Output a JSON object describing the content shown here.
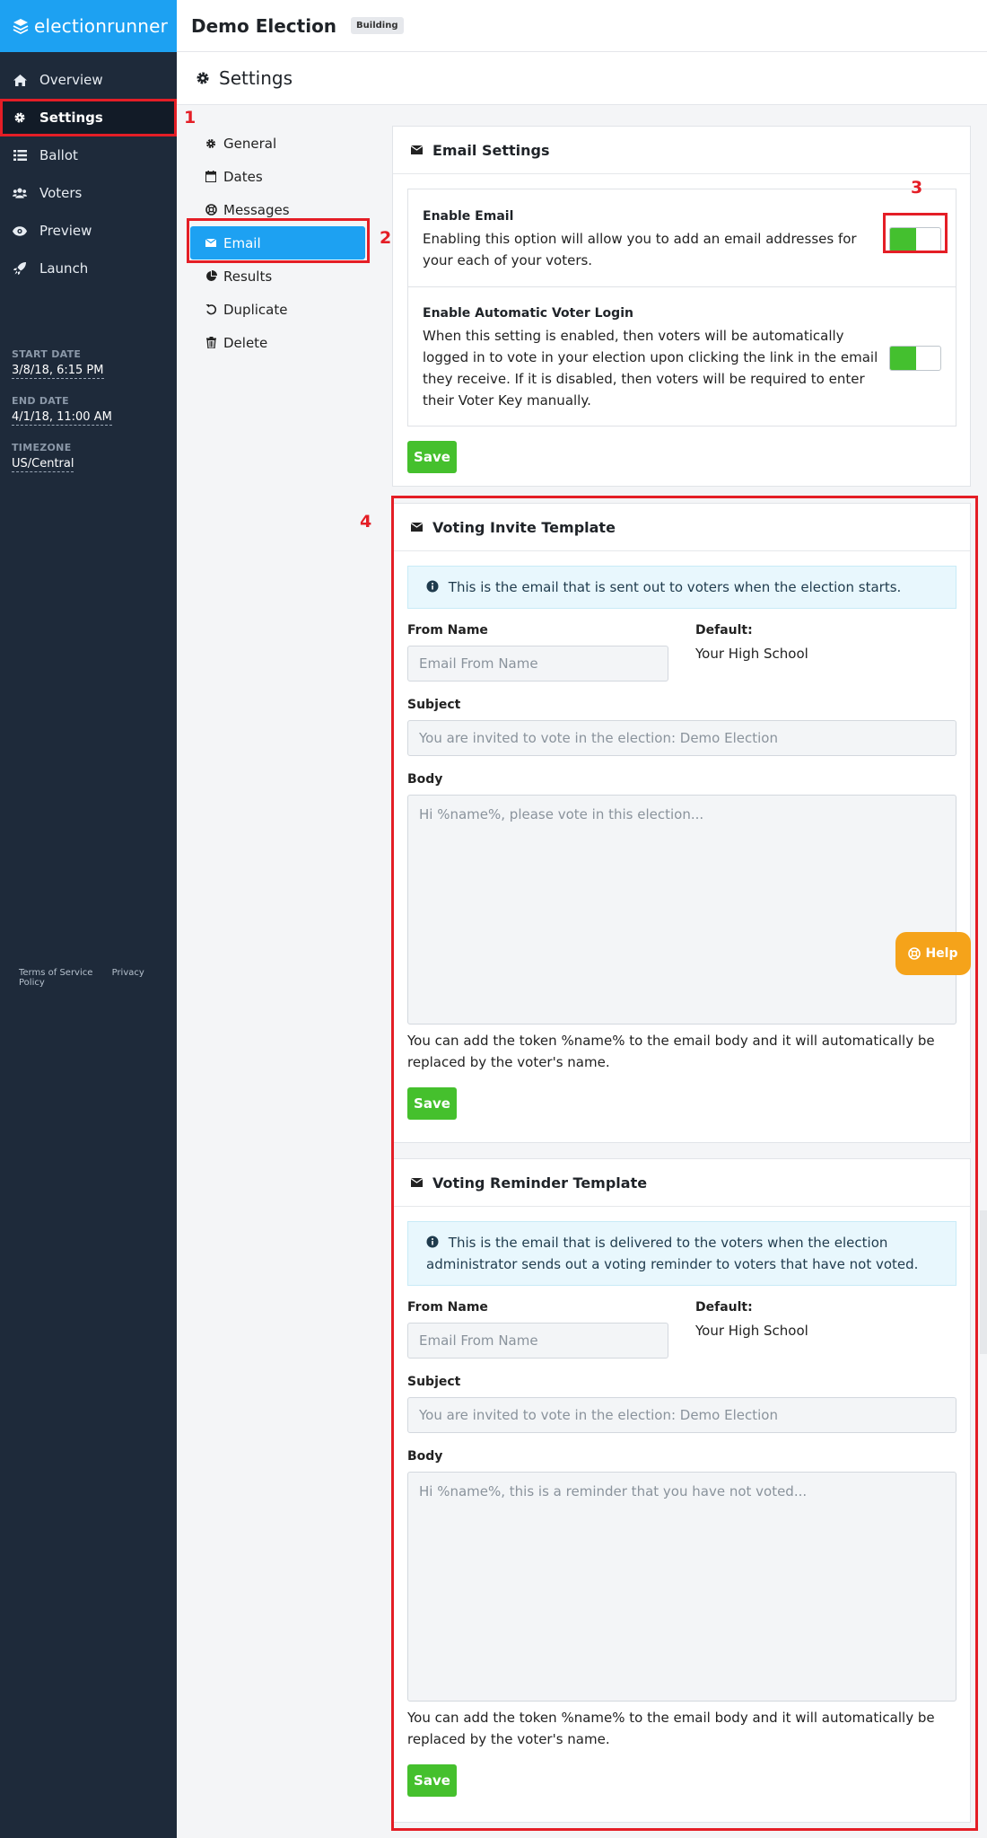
{
  "brand": {
    "name": "electionrunner"
  },
  "sidebar": {
    "items": [
      {
        "label": "Overview",
        "icon": "home-icon"
      },
      {
        "label": "Settings",
        "icon": "gear-icon"
      },
      {
        "label": "Ballot",
        "icon": "list-icon"
      },
      {
        "label": "Voters",
        "icon": "users-icon"
      },
      {
        "label": "Preview",
        "icon": "eye-icon"
      },
      {
        "label": "Launch",
        "icon": "rocket-icon"
      }
    ],
    "start_date": {
      "label": "START DATE",
      "value": "3/8/18, 6:15 PM"
    },
    "end_date": {
      "label": "END DATE",
      "value": "4/1/18, 11:00 AM"
    },
    "timezone": {
      "label": "TIMEZONE",
      "value": "US/Central"
    },
    "terms": "Terms of Service",
    "privacy": "Privacy Policy"
  },
  "header": {
    "title": "Demo Election",
    "status": "Building"
  },
  "page": {
    "title": "Settings"
  },
  "subnav": {
    "items": [
      {
        "label": "General"
      },
      {
        "label": "Dates"
      },
      {
        "label": "Messages"
      },
      {
        "label": "Email"
      },
      {
        "label": "Results"
      },
      {
        "label": "Duplicate"
      },
      {
        "label": "Delete"
      }
    ]
  },
  "email_settings": {
    "title": "Email Settings",
    "enable_email": {
      "title": "Enable Email",
      "description": "Enabling this option will allow you to add an email addresses for your each of your voters.",
      "enabled": true
    },
    "auto_login": {
      "title": "Enable Automatic Voter Login",
      "description": "When this setting is enabled, then voters will be automatically logged in to vote in your election upon clicking the link in the email they receive. If it is disabled, then voters will be required to enter their Voter Key manually.",
      "enabled": true
    },
    "save": "Save"
  },
  "invite_template": {
    "title": "Voting Invite Template",
    "info": "This is the email that is sent out to voters when the election starts.",
    "from_label": "From Name",
    "from_placeholder": "Email From Name",
    "default_label": "Default:",
    "default_value": "Your High School",
    "subject_label": "Subject",
    "subject_placeholder": "You are invited to vote in the election: Demo Election",
    "body_label": "Body",
    "body_placeholder": "Hi %name%, please vote in this election...",
    "hint": "You can add the token %name% to the email body and it will automatically be replaced by the voter's name.",
    "save": "Save"
  },
  "reminder_template": {
    "title": "Voting Reminder Template",
    "info": "This is the email that is delivered to the voters when the election administrator sends out a voting reminder to voters that have not voted.",
    "from_label": "From Name",
    "from_placeholder": "Email From Name",
    "default_label": "Default:",
    "default_value": "Your High School",
    "subject_label": "Subject",
    "subject_placeholder": "You are invited to vote in the election: Demo Election",
    "body_label": "Body",
    "body_placeholder": "Hi %name%, this is a reminder that you have not voted...",
    "hint": "You can add the token %name% to the email body and it will automatically be replaced by the voter's name.",
    "save": "Save"
  },
  "help": {
    "label": "Help"
  },
  "annotations": {
    "a1": "1",
    "a2": "2",
    "a3": "3",
    "a4": "4",
    "color": "#e41e26"
  }
}
